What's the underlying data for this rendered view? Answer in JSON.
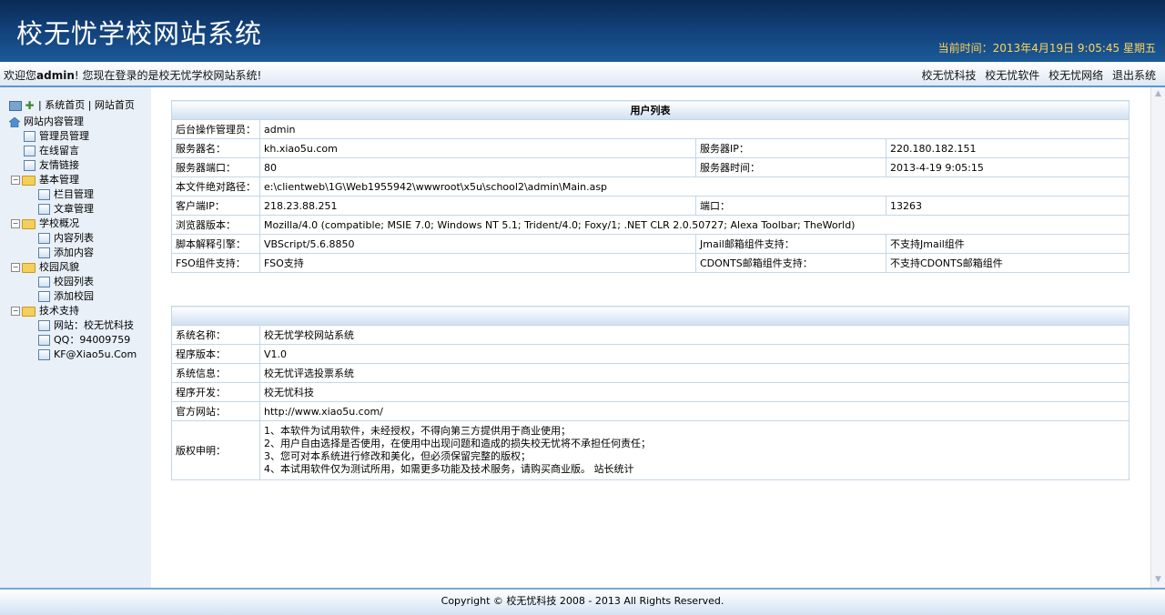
{
  "header": {
    "title": "校无忧学校网站系统",
    "datetime": "当前时间：2013年4月19日  9:05:45 星期五"
  },
  "welcome": {
    "prefix": "欢迎您",
    "user": "admin",
    "suffix": "! 您现在登录的是校无忧学校网站系统!",
    "links": [
      "校无忧科技",
      "校无忧软件",
      "校无忧网络",
      "退出系统"
    ]
  },
  "sidebar": {
    "top_links": "| 系统首页 | 网站首页",
    "root": "网站内容管理",
    "items": [
      {
        "label": "管理员管理",
        "type": "doc"
      },
      {
        "label": "在线留言",
        "type": "doc"
      },
      {
        "label": "友情链接",
        "type": "doc"
      },
      {
        "label": "基本管理",
        "type": "folder"
      },
      {
        "label": "栏目管理",
        "type": "doc"
      },
      {
        "label": "文章管理",
        "type": "doc"
      },
      {
        "label": "学校概况",
        "type": "folder"
      },
      {
        "label": "内容列表",
        "type": "doc"
      },
      {
        "label": "添加内容",
        "type": "doc"
      },
      {
        "label": "校园风貌",
        "type": "folder"
      },
      {
        "label": "校园列表",
        "type": "doc"
      },
      {
        "label": "添加校园",
        "type": "doc"
      },
      {
        "label": "技术支持",
        "type": "folder"
      },
      {
        "label": "网站：校无忧科技",
        "type": "doc"
      },
      {
        "label": "QQ：94009759",
        "type": "doc"
      },
      {
        "label": "KF@Xiao5u.Com",
        "type": "doc"
      }
    ]
  },
  "server_table": {
    "title": "用户列表",
    "rows": [
      {
        "l1": "后台操作管理员：",
        "v1": "admin"
      },
      {
        "l1": "服务器名：",
        "v1": "kh.xiao5u.com",
        "l2": "服务器IP：",
        "v2": "220.180.182.151"
      },
      {
        "l1": "服务器端口：",
        "v1": "80",
        "l2": "服务器时间：",
        "v2": "2013-4-19 9:05:15"
      },
      {
        "l1": "本文件绝对路径：",
        "v1": "e:\\clientweb\\1G\\Web1955942\\wwwroot\\x5u\\school2\\admin\\Main.asp"
      },
      {
        "l1": "客户端IP：",
        "v1": "218.23.88.251",
        "l2": "端口：",
        "v2": "13263"
      },
      {
        "l1": "浏览器版本：",
        "v1": "Mozilla/4.0 (compatible; MSIE 7.0; Windows NT 5.1; Trident/4.0; Foxy/1; .NET CLR 2.0.50727; Alexa Toolbar; TheWorld)"
      },
      {
        "l1": "脚本解释引擎：",
        "v1": "VBScript/5.6.8850",
        "l2": "Jmail邮箱组件支持：",
        "v2": "不支持Jmail组件"
      },
      {
        "l1": "FSO组件支持：",
        "v1": "FSO支持",
        "l2": "CDONTS邮箱组件支持：",
        "v2": "不支持CDONTS邮箱组件"
      }
    ]
  },
  "system_table": {
    "title": "",
    "rows": [
      {
        "l": "系统名称：",
        "v": "校无忧学校网站系统"
      },
      {
        "l": "程序版本：",
        "v": "V1.0"
      },
      {
        "l": "系统信息：",
        "v": "校无忧评选投票系统"
      },
      {
        "l": "程序开发：",
        "v": "校无忧科技"
      },
      {
        "l": "官方网站：",
        "v": "http://www.xiao5u.com/"
      }
    ],
    "copyright_label": "版权申明：",
    "copyright_lines": [
      "1、本软件为试用软件，未经授权，不得向第三方提供用于商业使用；",
      "2、用户自由选择是否使用，在使用中出现问题和造成的损失校无忧将不承担任何责任；",
      "3、您可对本系统进行修改和美化，但必须保留完整的版权；",
      "4、本试用软件仅为测试所用，如需更多功能及技术服务，请购买商业版。 站长统计"
    ]
  },
  "footer": {
    "text": "Copyright © 校无忧科技  2008 - 2013 All Rights Reserved."
  }
}
